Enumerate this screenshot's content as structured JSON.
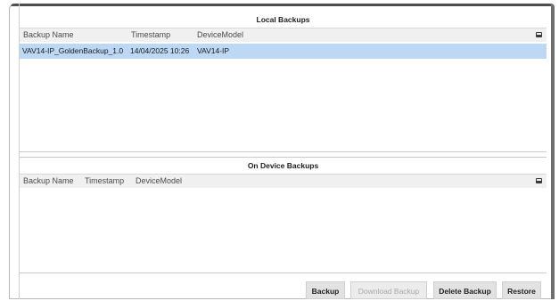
{
  "local_backups": {
    "title": "Local Backups",
    "columns": [
      "Backup Name",
      "Timestamp",
      "DeviceModel"
    ],
    "rows": [
      [
        "VAV14-IP_GoldenBackup_1.0",
        "14/04/2025 10:26",
        "VAV14-IP"
      ]
    ],
    "selected_row": 0
  },
  "device_backups": {
    "title": "On Device Backups",
    "columns": [
      "Backup Name",
      "Timestamp",
      "DeviceModel"
    ],
    "rows": []
  },
  "toolbar": {
    "backup_label": "Backup",
    "download_label": "Download Backup",
    "delete_label": "Delete Backup",
    "restore_label": "Restore"
  },
  "colors": {
    "selected_row": "#bcd8f5",
    "header_bg": "#f0f0f0",
    "button_bg": "#e2e2e2"
  }
}
